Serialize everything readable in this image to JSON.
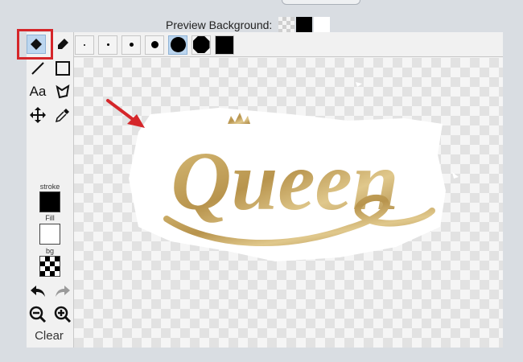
{
  "preview_background": {
    "label": "Preview Background:",
    "swatches": [
      "checker",
      "black",
      "white"
    ]
  },
  "tools": {
    "fill_tool": "fill-icon",
    "eraser": "eraser-icon",
    "line": "line-icon",
    "rectangle": "rectangle-icon",
    "text_label": "Aa",
    "lasso": "lasso-icon",
    "move": "move-icon",
    "eyedropper": "eyedropper-icon"
  },
  "brush_sizes": [
    "dot-1",
    "dot-2",
    "dot-3",
    "dot-4",
    "circle-large",
    "octagon",
    "square"
  ],
  "selected_brush_size": "circle-large",
  "colors": {
    "stroke_label": "stroke",
    "stroke_value": "#000000",
    "fill_label": "Fill",
    "fill_value": "#ffffff",
    "bg_label": "bg",
    "bg_value": "transparent"
  },
  "history": {
    "undo": "undo-icon",
    "redo": "redo-icon"
  },
  "zoom": {
    "zoom_out": "zoom-out-icon",
    "zoom_in": "zoom-in-icon"
  },
  "clear_label": "Clear",
  "canvas_image": {
    "text": "Queen",
    "gold": "#c6a560"
  },
  "accent_red": "#d5262a"
}
